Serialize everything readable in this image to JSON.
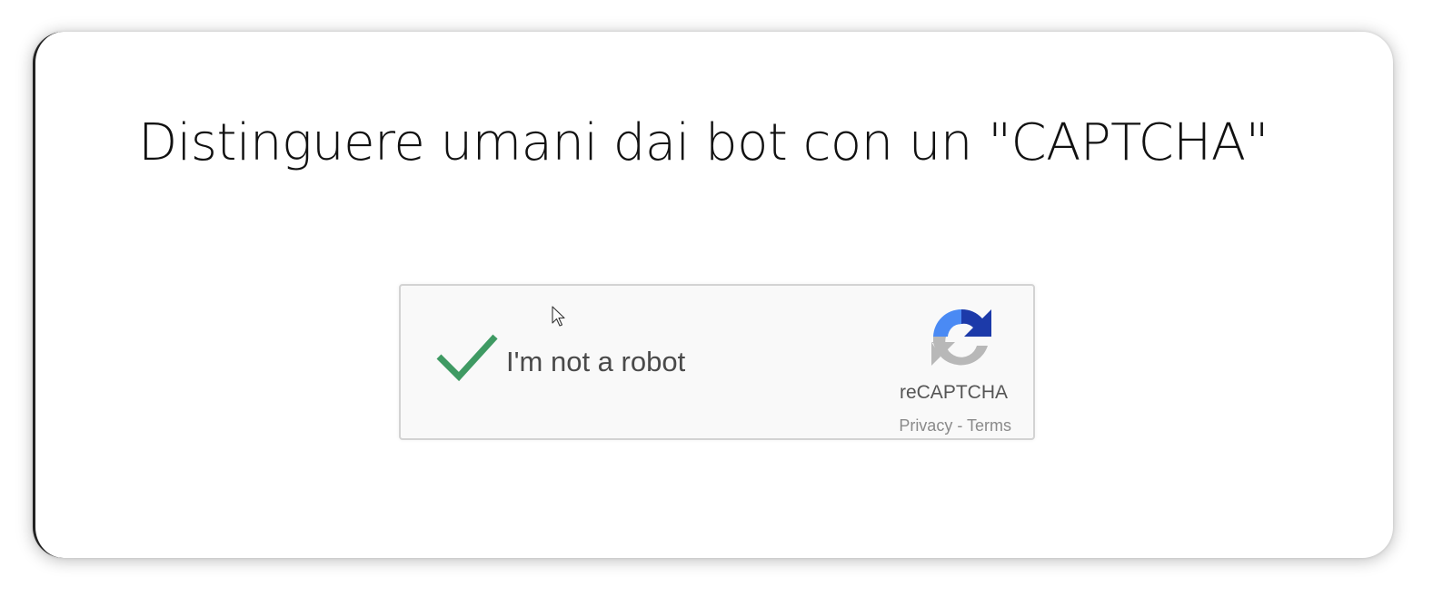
{
  "slide": {
    "title": "Distinguere umani dai bot con un \"CAPTCHA\""
  },
  "recaptcha": {
    "checkbox_label": "I'm not a robot",
    "checked": true,
    "brand": "reCAPTCHA",
    "privacy_label": "Privacy",
    "separator": " - ",
    "terms_label": "Terms",
    "icons": {
      "check": "checkmark-icon",
      "logo": "recaptcha-logo-icon",
      "cursor": "mouse-cursor-icon"
    },
    "colors": {
      "check": "#3f9a63",
      "logo_blue": "#4a8af4",
      "logo_dark_blue": "#1c3aa9",
      "logo_gray": "#b8b8b8",
      "widget_bg": "#f9f9f9",
      "widget_border": "#d3d3d3"
    }
  }
}
